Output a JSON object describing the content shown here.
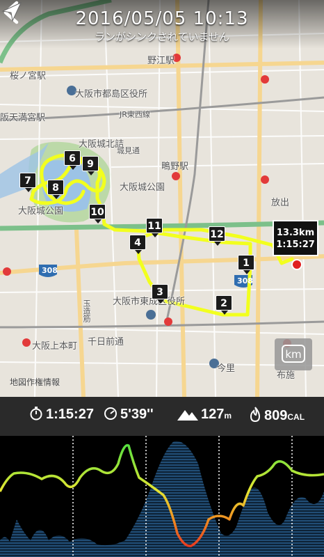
{
  "header": {
    "date_time": "2016/05/05   10:13",
    "sync_status": "ランがシンクされていません",
    "back_icon": "chevron-left-icon"
  },
  "map": {
    "labels": [
      {
        "text": "野江駅",
        "cls": ""
      },
      {
        "text": "大阪市都島区役所",
        "cls": ""
      },
      {
        "text": "JR東西線",
        "cls": "small"
      },
      {
        "text": "阪天満宮駅",
        "cls": ""
      },
      {
        "text": "桜ノ宮駅",
        "cls": ""
      },
      {
        "text": "大阪城北詰",
        "cls": ""
      },
      {
        "text": "城見通",
        "cls": "small"
      },
      {
        "text": "鴫野駅",
        "cls": ""
      },
      {
        "text": "大阪城公園",
        "cls": ""
      },
      {
        "text": "放出",
        "cls": ""
      },
      {
        "text": "大阪城公園",
        "cls": ""
      },
      {
        "text": "大阪市東成区役所",
        "cls": ""
      },
      {
        "text": "千日前通",
        "cls": ""
      },
      {
        "text": "今里",
        "cls": ""
      },
      {
        "text": "玉造筋",
        "cls": "small"
      },
      {
        "text": "大阪上本町",
        "cls": ""
      },
      {
        "text": "布施",
        "cls": ""
      },
      {
        "text": "308",
        "cls": "small"
      },
      {
        "text": "308",
        "cls": "small"
      }
    ],
    "split_markers": [
      "1",
      "2",
      "3",
      "4",
      "6",
      "7",
      "8",
      "9",
      "10",
      "11",
      "12"
    ],
    "callout": {
      "distance": "13.3km",
      "time": "1:15:27"
    },
    "attribution": "地図作権情報",
    "unit_toggle": "km",
    "colors": {
      "route": "#f2ff1e",
      "endpoint": "#e02020"
    }
  },
  "stats": {
    "duration": {
      "icon": "stopwatch-icon",
      "value": "1:15:27"
    },
    "pace": {
      "icon": "speedometer-icon",
      "value": "5'39''"
    },
    "elevation": {
      "icon": "mountain-icon",
      "value": "127",
      "unit": "m"
    },
    "calories": {
      "icon": "flame-icon",
      "value": "809",
      "unit": "CAL"
    }
  }
}
